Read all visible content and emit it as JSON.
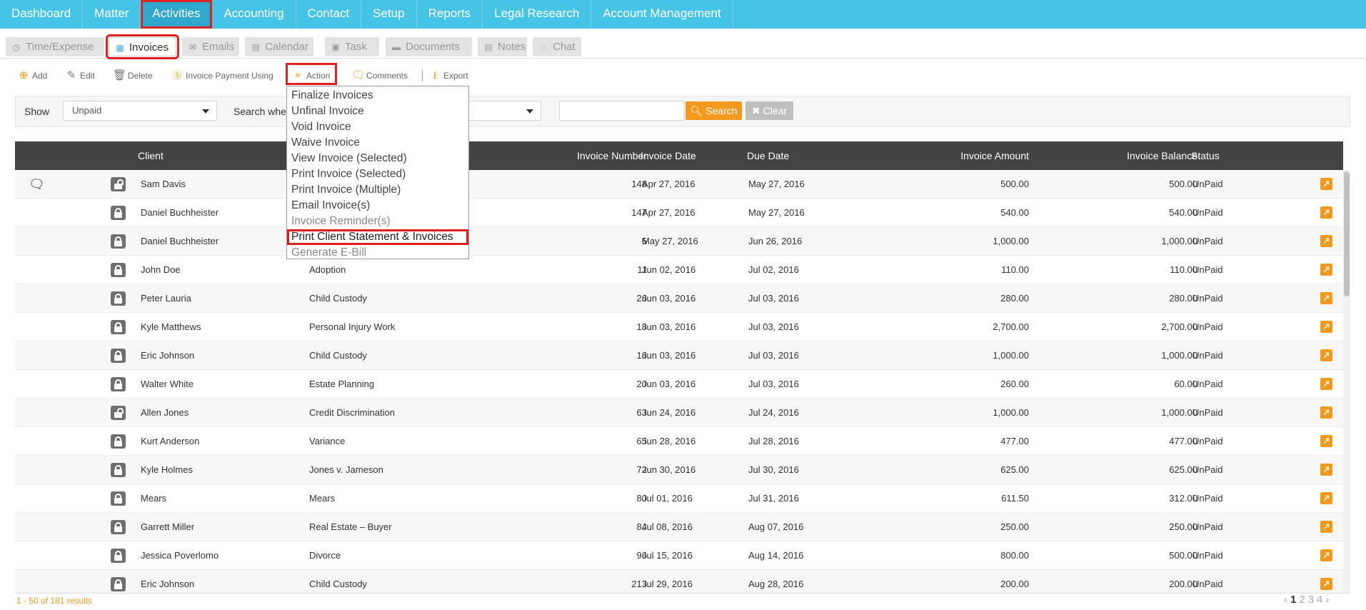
{
  "nav": {
    "items": [
      "Dashboard",
      "Matter",
      "Activities",
      "Accounting",
      "Contact",
      "Setup",
      "Reports",
      "Legal Research",
      "Account Management"
    ],
    "active": "Activities"
  },
  "subtabs": {
    "items": [
      {
        "label": "Time/Expense",
        "icon": "clock-icon"
      },
      {
        "label": "Invoices",
        "icon": "calculator-icon"
      },
      {
        "label": "Emails",
        "icon": "envelope-icon"
      },
      {
        "label": "Calendar",
        "icon": "calendar-icon"
      },
      {
        "label": "Task",
        "icon": "task-icon"
      },
      {
        "label": "Documents",
        "icon": "folder-icon"
      },
      {
        "label": "Notes",
        "icon": "note-icon"
      },
      {
        "label": "Chat",
        "icon": "chat-icon"
      }
    ],
    "active": "Invoices"
  },
  "toolbar": {
    "add": "Add",
    "edit": "Edit",
    "delete": "Delete",
    "invoice_payment": "Invoice Payment Using",
    "action": "Action",
    "comments": "Comments",
    "export": "Export"
  },
  "filter": {
    "show_label": "Show",
    "show_value": "Unpaid",
    "search_label": "Search wher",
    "search_button": "Search",
    "clear_button": "Clear"
  },
  "action_menu": {
    "items": [
      "Finalize Invoices",
      "Unfinal Invoice",
      "Void Invoice",
      "Waive Invoice",
      "View Invoice (Selected)",
      "Print Invoice (Selected)",
      "Print Invoice (Multiple)",
      "Email Invoice(s)",
      "Invoice Reminder(s)",
      "Print Client Statement & Invoices",
      "Generate E-Bill"
    ],
    "highlighted": "Print Client Statement & Invoices"
  },
  "table": {
    "headers": {
      "client": "Client",
      "invoice_number": "Invoice Number",
      "invoice_date": "Invoice Date",
      "due_date": "Due Date",
      "invoice_amount": "Invoice Amount",
      "invoice_balance": "Invoice Balance",
      "status": "Status"
    },
    "rows": [
      {
        "client": "Sam Davis",
        "matter": "",
        "number": "148",
        "date": "Apr 27, 2016",
        "due": "May 27, 2016",
        "amount": "500.00",
        "balance": "500.00",
        "status": "UnPaid",
        "lock": "open",
        "chat": true
      },
      {
        "client": "Daniel Buchheister",
        "matter": "",
        "number": "147",
        "date": "Apr 27, 2016",
        "due": "May 27, 2016",
        "amount": "540.00",
        "balance": "540.00",
        "status": "UnPaid",
        "lock": "closed",
        "chat": false
      },
      {
        "client": "Daniel Buchheister",
        "matter": "",
        "number": "5",
        "date": "May 27, 2016",
        "due": "Jun 26, 2016",
        "amount": "1,000.00",
        "balance": "1,000.00",
        "status": "UnPaid",
        "lock": "closed",
        "chat": false
      },
      {
        "client": "John Doe",
        "matter": "Adoption",
        "number": "11",
        "date": "Jun 02, 2016",
        "due": "Jul 02, 2016",
        "amount": "110.00",
        "balance": "110.00",
        "status": "UnPaid",
        "lock": "closed",
        "chat": false
      },
      {
        "client": "Peter Lauria",
        "matter": "Child Custody",
        "number": "26",
        "date": "Jun 03, 2016",
        "due": "Jul 03, 2016",
        "amount": "280.00",
        "balance": "280.00",
        "status": "UnPaid",
        "lock": "closed",
        "chat": false
      },
      {
        "client": "Kyle Matthews",
        "matter": "Personal Injury Work",
        "number": "18",
        "date": "Jun 03, 2016",
        "due": "Jul 03, 2016",
        "amount": "2,700.00",
        "balance": "2,700.00",
        "status": "UnPaid",
        "lock": "closed",
        "chat": false
      },
      {
        "client": "Eric Johnson",
        "matter": "Child Custody",
        "number": "16",
        "date": "Jun 03, 2016",
        "due": "Jul 03, 2016",
        "amount": "1,000.00",
        "balance": "1,000.00",
        "status": "UnPaid",
        "lock": "closed",
        "chat": false
      },
      {
        "client": "Walter White",
        "matter": "Estate Planning",
        "number": "20",
        "date": "Jun 03, 2016",
        "due": "Jul 03, 2016",
        "amount": "260.00",
        "balance": "60.00",
        "status": "UnPaid",
        "lock": "closed",
        "chat": false
      },
      {
        "client": "Allen Jones",
        "matter": "Credit Discrimination",
        "number": "63",
        "date": "Jun 24, 2016",
        "due": "Jul 24, 2016",
        "amount": "1,000.00",
        "balance": "1,000.00",
        "status": "UnPaid",
        "lock": "open",
        "chat": false
      },
      {
        "client": "Kurt Anderson",
        "matter": "Variance",
        "number": "65",
        "date": "Jun 28, 2016",
        "due": "Jul 28, 2016",
        "amount": "477.00",
        "balance": "477.00",
        "status": "UnPaid",
        "lock": "closed",
        "chat": false
      },
      {
        "client": "Kyle Holmes",
        "matter": "Jones v. Jameson",
        "number": "72",
        "date": "Jun 30, 2016",
        "due": "Jul 30, 2016",
        "amount": "625.00",
        "balance": "625.00",
        "status": "UnPaid",
        "lock": "closed",
        "chat": false
      },
      {
        "client": "Mears",
        "matter": "Mears",
        "number": "80",
        "date": "Jul 01, 2016",
        "due": "Jul 31, 2016",
        "amount": "611.50",
        "balance": "312.00",
        "status": "UnPaid",
        "lock": "closed",
        "chat": false
      },
      {
        "client": "Garrett Miller",
        "matter": "Real Estate – Buyer",
        "number": "84",
        "date": "Jul 08, 2016",
        "due": "Aug 07, 2016",
        "amount": "250.00",
        "balance": "250.00",
        "status": "UnPaid",
        "lock": "closed",
        "chat": false
      },
      {
        "client": "Jessica Poverlomo",
        "matter": "Divorce",
        "number": "96",
        "date": "Jul 15, 2016",
        "due": "Aug 14, 2016",
        "amount": "800.00",
        "balance": "500.00",
        "status": "UnPaid",
        "lock": "closed",
        "chat": false
      },
      {
        "client": "Eric Johnson",
        "matter": "Child Custody",
        "number": "213",
        "date": "Jul 29, 2016",
        "due": "Aug 28, 2016",
        "amount": "200.00",
        "balance": "200.00",
        "status": "UnPaid",
        "lock": "closed",
        "chat": false
      }
    ]
  },
  "footer": {
    "results": "1 - 50 of 181 results",
    "pages": [
      "1",
      "2",
      "3",
      "4"
    ],
    "current_page": "1",
    "prev": "‹",
    "next": "›"
  }
}
